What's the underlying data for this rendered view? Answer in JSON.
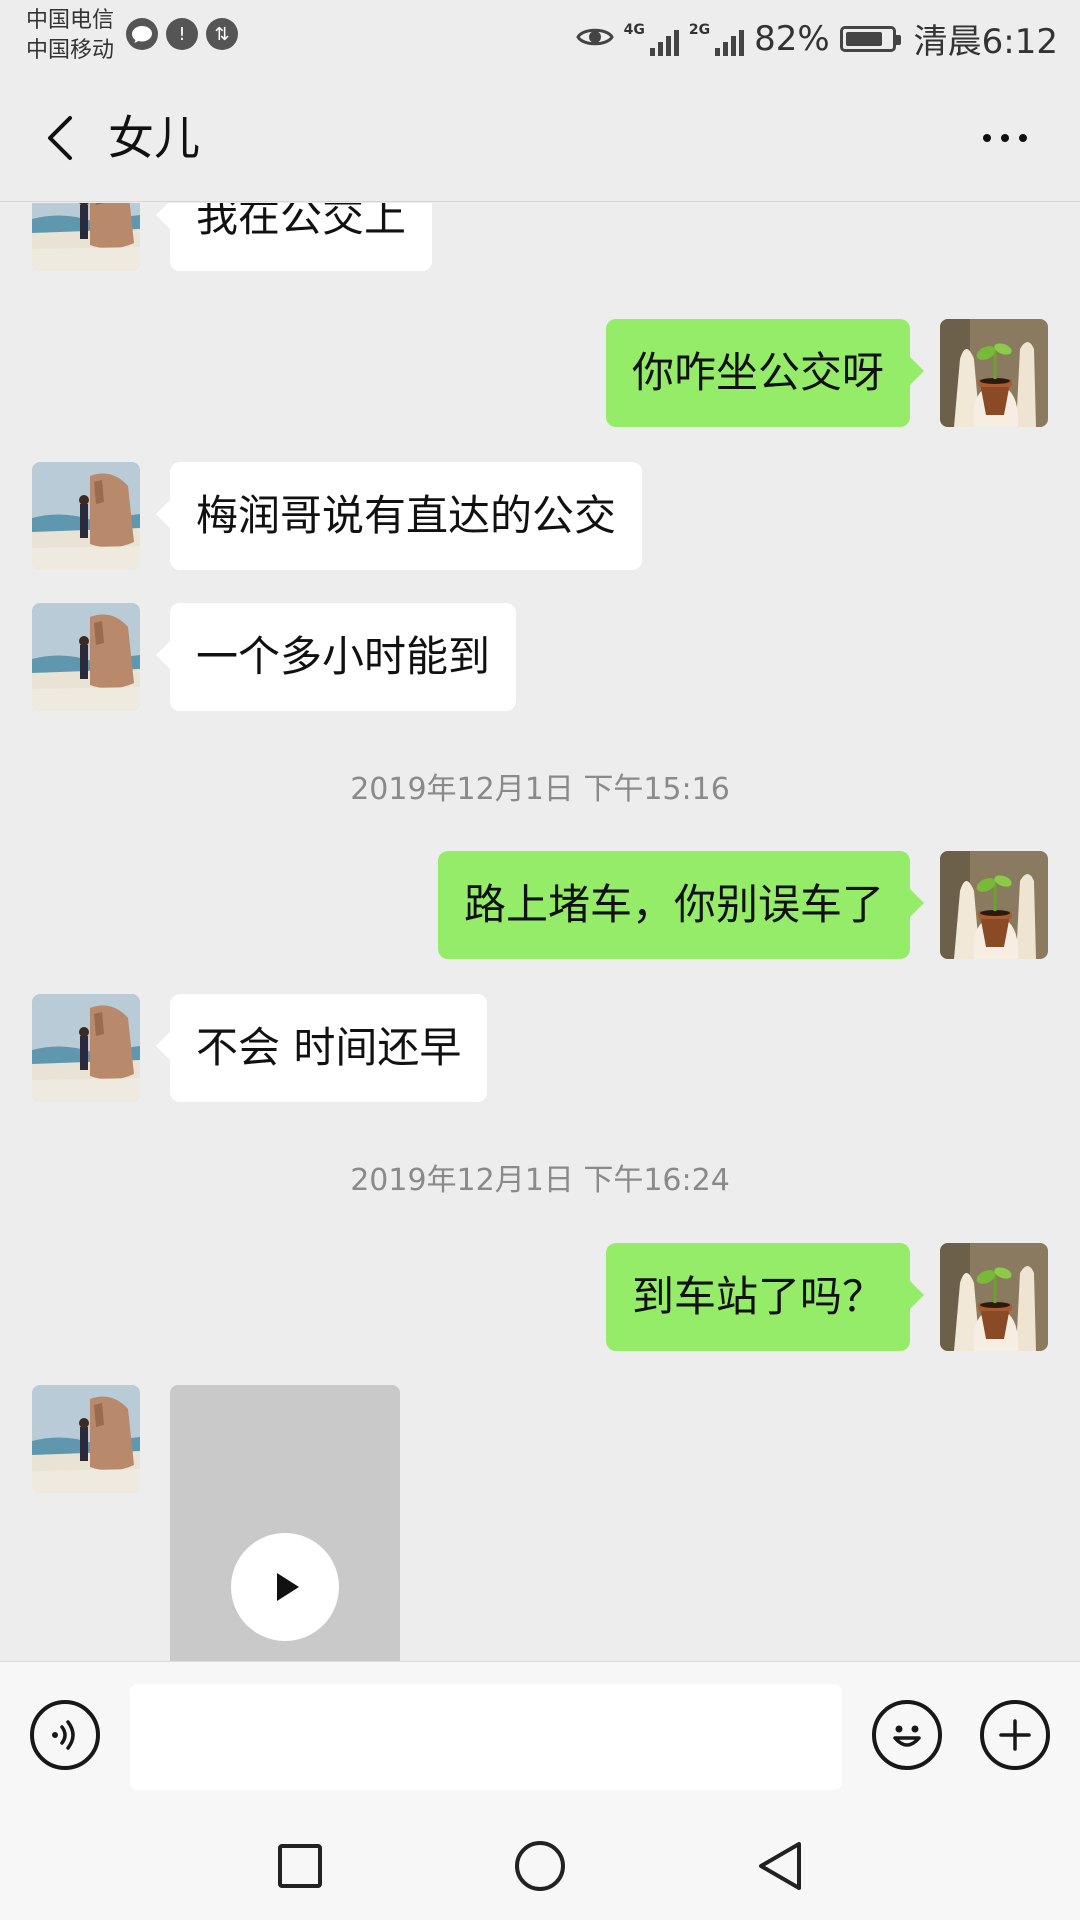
{
  "status_bar": {
    "carrier_1": "中国电信",
    "carrier_2": "中国移动",
    "network_1": "4G",
    "network_2": "2G",
    "battery_text": "82%",
    "battery_level": 0.82,
    "time": "清晨6:12",
    "left_icons": [
      "chat-bubble-icon",
      "cloud-warning-icon",
      "data-transfer-icon"
    ]
  },
  "header": {
    "title": "女儿"
  },
  "messages": [
    {
      "side": "in",
      "text": "我在公交上"
    },
    {
      "side": "out",
      "text": "你咋坐公交呀"
    },
    {
      "side": "in",
      "text": "梅润哥说有直达的公交"
    },
    {
      "side": "in",
      "text": "一个多小时能到"
    },
    {
      "timestamp": "2019年12月1日 下午15:16"
    },
    {
      "side": "out",
      "text": "路上堵车，你别误车了"
    },
    {
      "side": "in",
      "text": "不会 时间还早"
    },
    {
      "timestamp": "2019年12月1日 下午16:24"
    },
    {
      "side": "out",
      "text": "到车站了吗？"
    },
    {
      "side": "in",
      "type": "video"
    }
  ],
  "input_bar": {
    "text_value": ""
  },
  "colors": {
    "outgoing_bubble": "#95ec69",
    "incoming_bubble": "#ffffff",
    "background": "#ededed"
  }
}
